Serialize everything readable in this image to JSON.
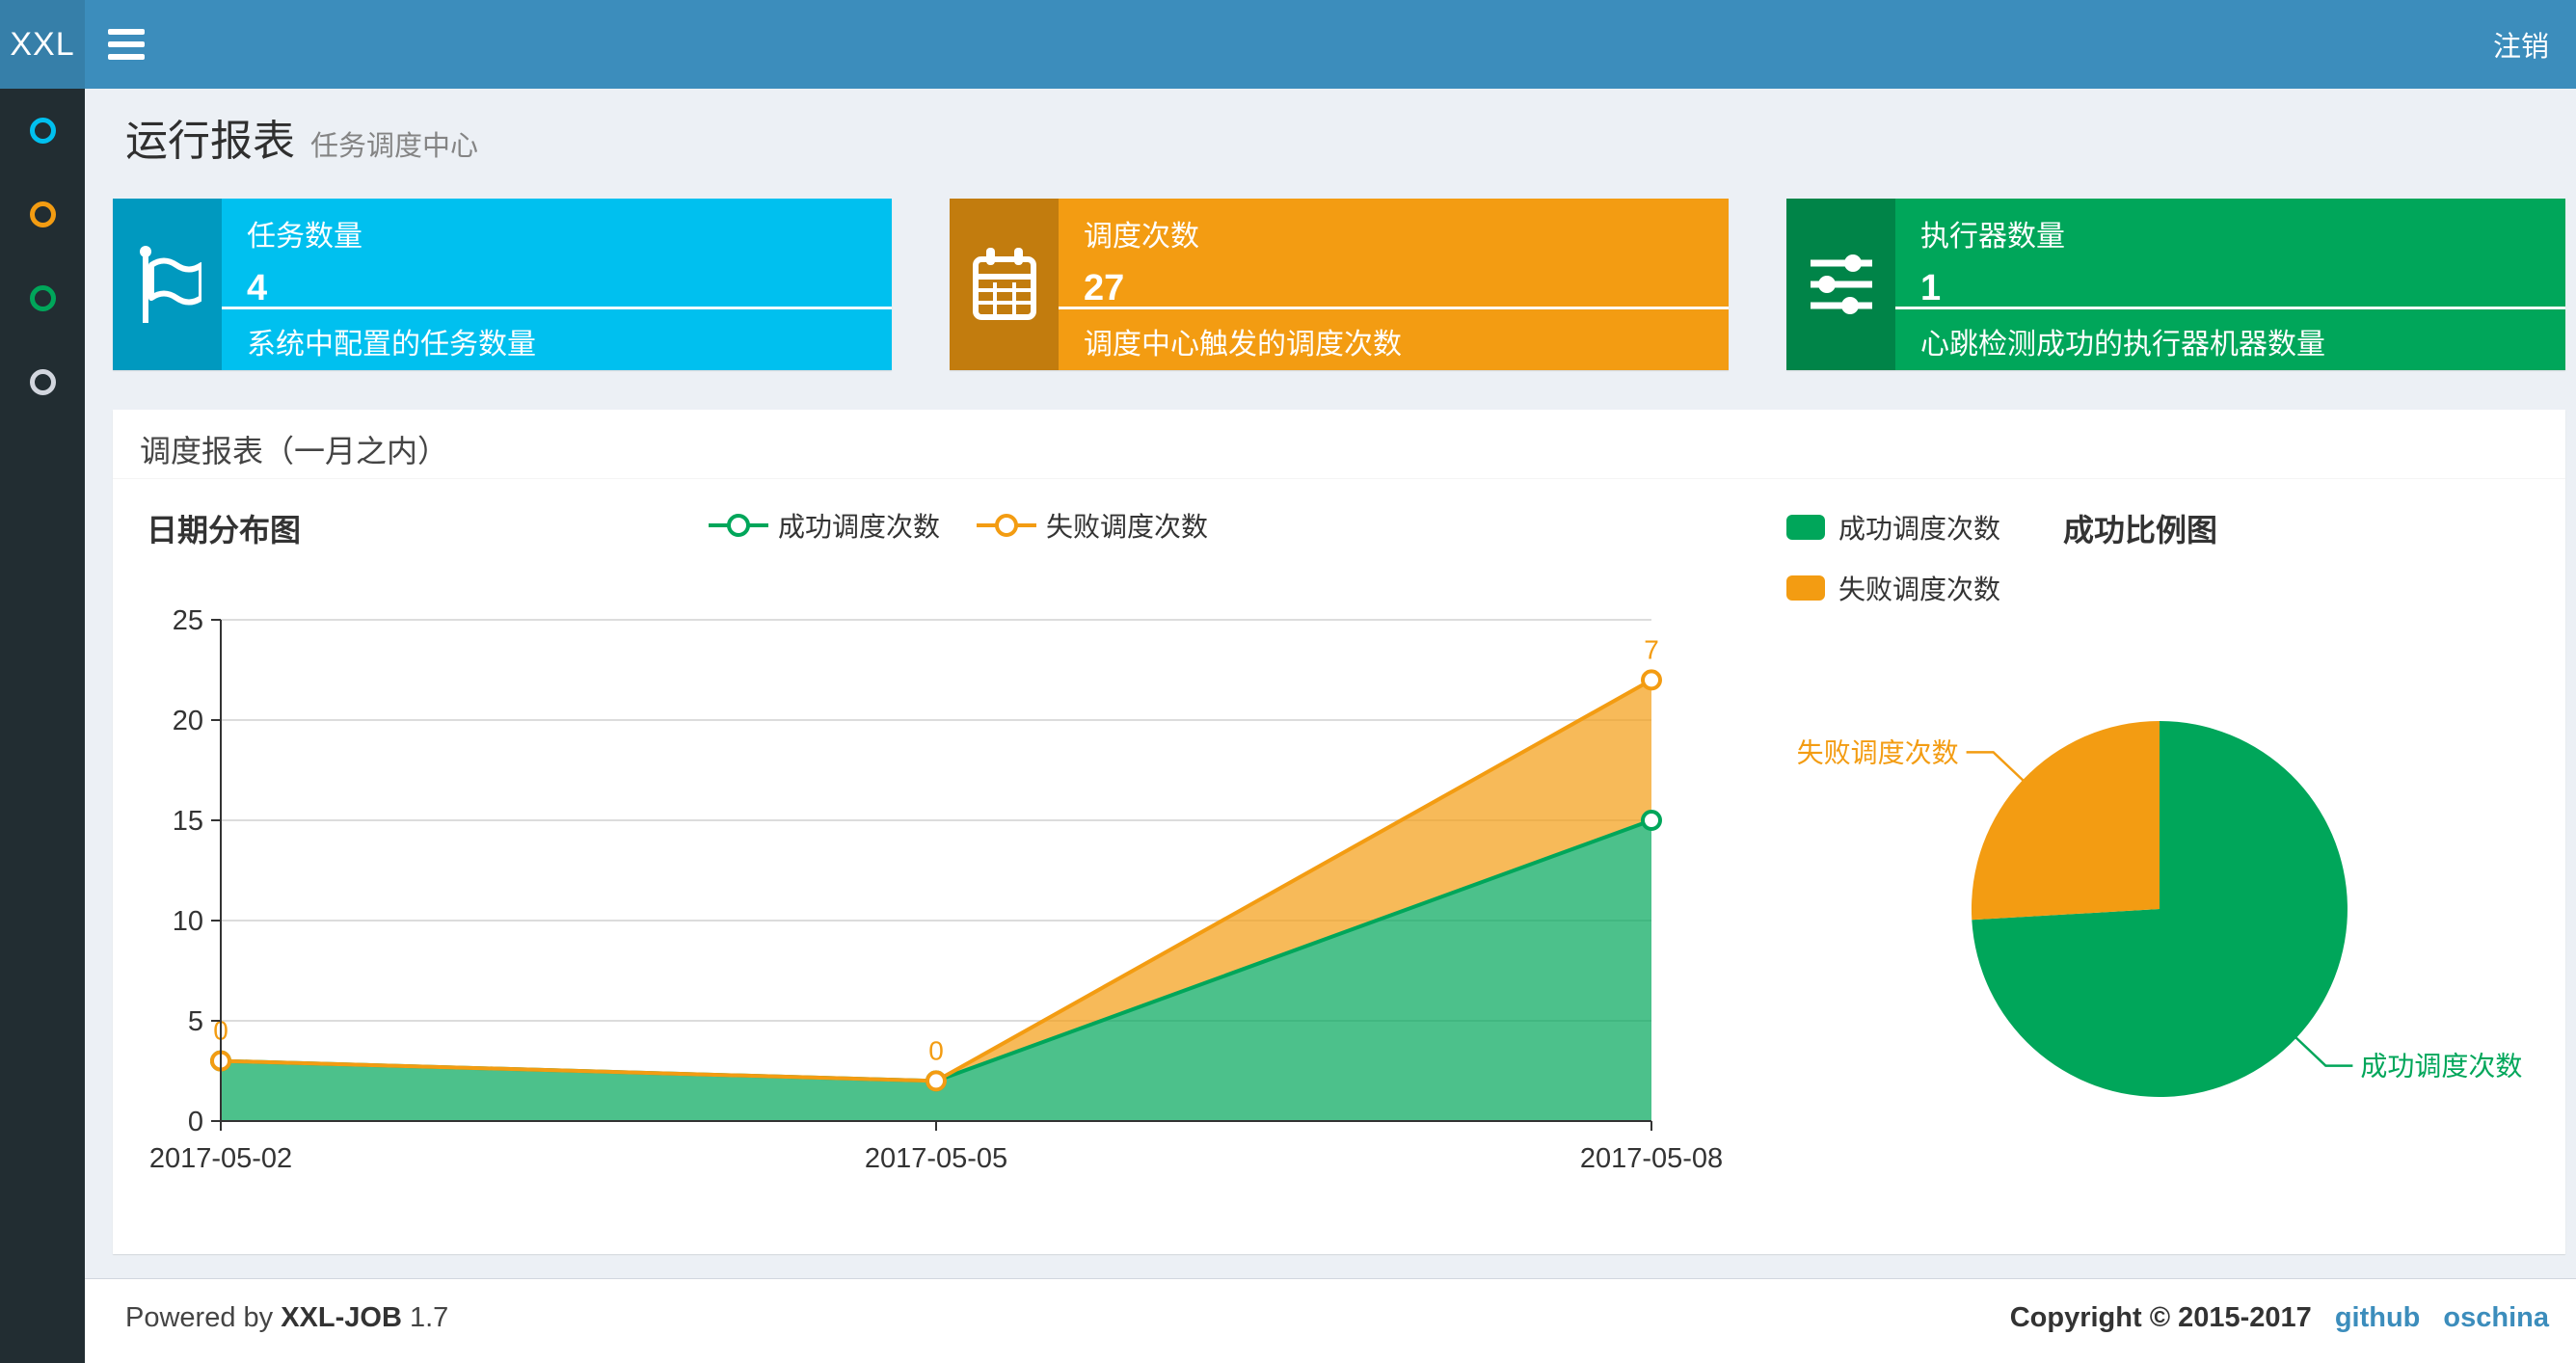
{
  "navbar": {
    "logo": "XXL",
    "logout_label": "注销",
    "bg": "#3c8dbc",
    "logo_bg": "#367fa9"
  },
  "sidebar": {
    "bg": "#222d32",
    "items": [
      {
        "icon": "circle-icon",
        "color": "#00c0ef"
      },
      {
        "icon": "circle-icon",
        "color": "#f39c12"
      },
      {
        "icon": "circle-icon",
        "color": "#00a65a"
      },
      {
        "icon": "circle-icon",
        "color": "#d2d6de"
      }
    ]
  },
  "page": {
    "title": "运行报表",
    "subtitle": "任务调度中心"
  },
  "info_boxes": [
    {
      "icon": "flag-icon",
      "title": "任务数量",
      "value": "4",
      "description": "系统中配置的任务数量",
      "color": "#00c0ef"
    },
    {
      "icon": "calendar-icon",
      "title": "调度次数",
      "value": "27",
      "description": "调度中心触发的调度次数",
      "color": "#f39c12"
    },
    {
      "icon": "sliders-icon",
      "title": "执行器数量",
      "value": "1",
      "description": "心跳检测成功的执行器机器数量",
      "color": "#00a65a"
    }
  ],
  "panel": {
    "title": "调度报表（一月之内）"
  },
  "chart_data": [
    {
      "type": "area",
      "title": "日期分布图",
      "x": [
        "2017-05-02",
        "2017-05-05",
        "2017-05-08"
      ],
      "series": [
        {
          "name": "成功调度次数",
          "color": "#00a65a",
          "values": [
            3,
            2,
            15
          ]
        },
        {
          "name": "失败调度次数",
          "color": "#f39c12",
          "values": [
            0,
            0,
            7
          ],
          "point_labels": [
            "0",
            "0",
            "7"
          ]
        }
      ],
      "stacked": true,
      "ylim": [
        0,
        25
      ],
      "yticks": [
        0,
        5,
        10,
        15,
        20,
        25
      ],
      "grid": true,
      "legend_position": "top-center"
    },
    {
      "type": "pie",
      "title": "成功比例图",
      "labels": [
        "成功调度次数",
        "失败调度次数"
      ],
      "values": [
        20,
        7
      ],
      "colors": [
        "#00a65a",
        "#f39c12"
      ],
      "start_angle": 90,
      "clockwise": true,
      "legend_position": "top-left"
    }
  ],
  "footer": {
    "powered_by": "Powered by",
    "product": "XXL-JOB",
    "version": "1.7",
    "copyright": "Copyright © 2015-2017",
    "links": [
      "github",
      "oschina"
    ]
  }
}
